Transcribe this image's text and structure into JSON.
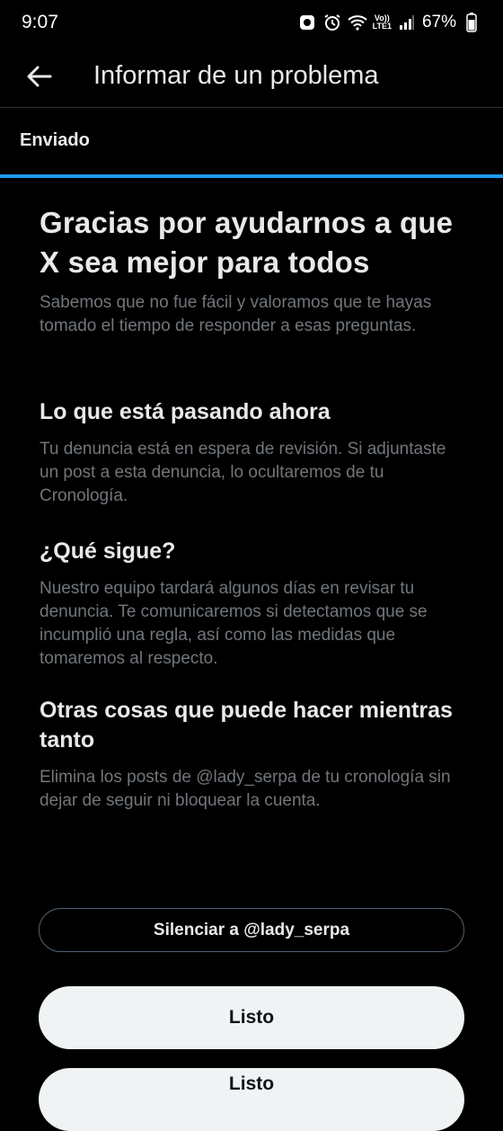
{
  "status_bar": {
    "time": "9:07",
    "lte_line1": "Vo))",
    "lte_line2": "LTE1",
    "battery": "67%"
  },
  "header": {
    "title": "Informar de un problema",
    "back_icon": "arrow-left-icon"
  },
  "tab": {
    "label": "Enviado",
    "accent": "#1d9bf0"
  },
  "main": {
    "heading": "Gracias por ayudarnos a que X sea mejor para todos",
    "subheading": "Sabemos que no fue fácil y valoramos que te hayas tomado el tiempo de responder a esas preguntas.",
    "sections": [
      {
        "title": "Lo que está pasando ahora",
        "body": "Tu denuncia está en espera de revisión. Si adjuntaste un post a esta denuncia, lo ocultaremos de tu Cronología."
      },
      {
        "title": "¿Qué sigue?",
        "body": "Nuestro equipo tardará algunos días en revisar tu denuncia. Te comunicaremos si detectamos que se incumplió una regla, así como las medidas que tomaremos al respecto."
      },
      {
        "title": "Otras cosas que puede hacer mientras tanto",
        "body": "Elimina los posts de @lady_serpa de tu cronología sin dejar de seguir ni bloquear la cuenta."
      }
    ]
  },
  "buttons": {
    "mute": "Silenciar a @lady_serpa",
    "done": "Listo",
    "peek": "Listo"
  }
}
